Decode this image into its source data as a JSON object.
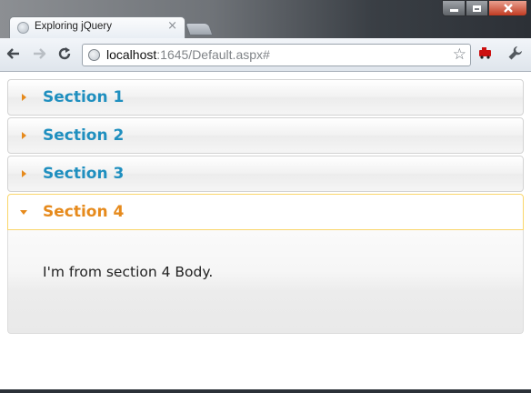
{
  "browser": {
    "tab_title": "Exploring jQuery",
    "tab_close_glyph": "×",
    "url_host": "localhost",
    "url_rest": ":1645/Default.aspx#",
    "icons": [
      "back-arrow-icon",
      "forward-arrow-icon",
      "reload-icon",
      "globe-icon",
      "bookmark-star-icon",
      "extension-icon",
      "wrench-icon"
    ]
  },
  "accordion": {
    "sections": [
      {
        "label": "Section 1"
      },
      {
        "label": "Section 2"
      },
      {
        "label": "Section 3"
      },
      {
        "label": "Section 4",
        "active": true
      }
    ],
    "active_body": "I'm from section 4 Body.",
    "colors": {
      "header_text": "#1f8fbf",
      "active_text": "#e68a1c",
      "active_border": "#fad66a"
    }
  }
}
